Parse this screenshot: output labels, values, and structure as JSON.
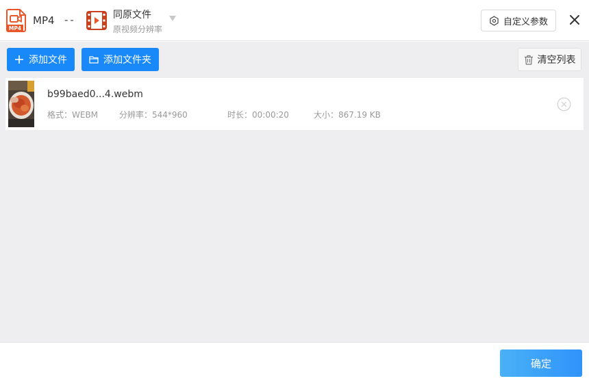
{
  "header": {
    "source_format_label": "MP4",
    "source_icon_badge": "MP4",
    "separator": "--",
    "target_title": "同原文件",
    "target_subtitle": "原视频分辨率",
    "custom_params_label": "自定义参数"
  },
  "toolbar": {
    "add_file_label": "添加文件",
    "add_folder_label": "添加文件夹",
    "clear_list_label": "清空列表"
  },
  "files": [
    {
      "name": "b99baed0...4.webm",
      "format": "格式：WEBM",
      "resolution": "分辨率：544*960",
      "duration": "时长：00:00:20",
      "size": "大小：867.19 KB"
    }
  ],
  "footer": {
    "confirm_label": "确定"
  },
  "colors": {
    "primary_blue": "#1989fa",
    "icon_orange": "#e8562a",
    "content_bg": "#eeedf0"
  }
}
